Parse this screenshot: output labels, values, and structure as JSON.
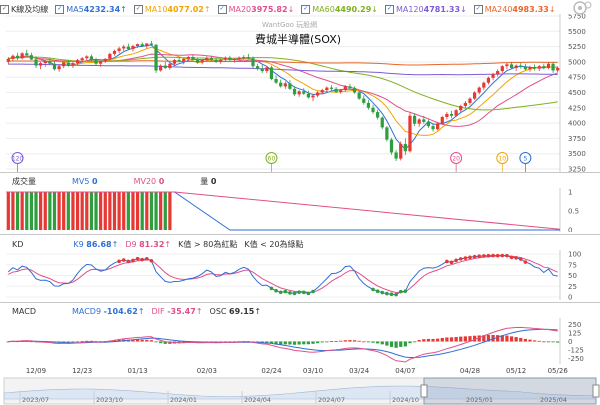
{
  "watermark": "WantGoo 玩股網",
  "price": {
    "title": "費城半導體(SOX)",
    "legend_prefix": "K線及均線",
    "ma": [
      {
        "label": "MA5",
        "value": "4232.34",
        "arrow": "↑",
        "color": "#2f6fd6"
      },
      {
        "label": "MA10",
        "value": "4077.02",
        "arrow": "↑",
        "color": "#f0a500"
      },
      {
        "label": "MA20",
        "value": "3975.82",
        "arrow": "↓",
        "color": "#e0508a"
      },
      {
        "label": "MA60",
        "value": "4490.29",
        "arrow": "↓",
        "color": "#80b020"
      },
      {
        "label": "MA120",
        "value": "4781.33",
        "arrow": "↓",
        "color": "#7b5cd6"
      },
      {
        "label": "MA240",
        "value": "4983.33",
        "arrow": "↓",
        "color": "#e8652a"
      }
    ],
    "markers": [
      {
        "label": "120",
        "x_index": 2,
        "color": "#7b5cd6"
      },
      {
        "label": "60",
        "x_index": 57,
        "color": "#80b020"
      },
      {
        "label": "20",
        "x_index": 97,
        "color": "#e0508a"
      },
      {
        "label": "10",
        "x_index": 107,
        "color": "#f0a500"
      },
      {
        "label": "5",
        "x_index": 112,
        "color": "#2f6fd6"
      }
    ]
  },
  "volume": {
    "label": "成交量",
    "mv5_label": "MV5",
    "mv5_value": "0",
    "mv20_label": "MV20",
    "mv20_value": "0",
    "qty_label": "量",
    "qty_value": "0"
  },
  "kd": {
    "label": "KD",
    "k_label": "K9",
    "k_value": "86.68",
    "k_arrow": "↑",
    "d_label": "D9",
    "d_value": "81.32",
    "d_arrow": "↑",
    "note1": "K值 > 80為紅點",
    "note2": "K值 < 20為綠點"
  },
  "macd": {
    "label": "MACD",
    "macd_label": "MACD9",
    "macd_value": "-104.62",
    "macd_arrow": "↑",
    "dif_label": "DIF",
    "dif_value": "-35.47",
    "dif_arrow": "↑",
    "osc_label": "OSC",
    "osc_value": "69.15",
    "osc_arrow": "↑"
  },
  "colors": {
    "up": "#e53935",
    "down": "#2e9e3e",
    "k_line": "#2f6fd6",
    "d_line": "#e0508a",
    "bar_green": "#2e9e3e",
    "bar_red": "#e53935"
  },
  "chart_data": {
    "type": "candlestick",
    "title": "費城半導體(SOX)",
    "date_labels": [
      {
        "label": "12/09",
        "index": 6
      },
      {
        "label": "12/23",
        "index": 16
      },
      {
        "label": "01/13",
        "index": 28
      },
      {
        "label": "02/03",
        "index": 43
      },
      {
        "label": "02/24",
        "index": 57
      },
      {
        "label": "03/10",
        "index": 66
      },
      {
        "label": "03/24",
        "index": 76
      },
      {
        "label": "04/07",
        "index": 86
      },
      {
        "label": "04/28",
        "index": 100
      },
      {
        "label": "05/12",
        "index": 110
      },
      {
        "label": "05/26",
        "index": 119
      }
    ],
    "overview_labels": [
      "2023/07",
      "2023/10",
      "2024/01",
      "2024/04",
      "2024/07",
      "2024/10",
      "2025/01",
      "2025/04"
    ],
    "price_axis": {
      "min": 3250,
      "max": 5750,
      "ticks": [
        5750,
        5500,
        5250,
        5000,
        4750,
        4500,
        4250,
        4000,
        3750,
        3500,
        3250
      ]
    },
    "ohlc": [
      [
        5000,
        5080,
        4960,
        5050
      ],
      [
        5050,
        5120,
        5010,
        5100
      ],
      [
        5100,
        5150,
        5030,
        5060
      ],
      [
        5060,
        5160,
        5040,
        5140
      ],
      [
        5140,
        5200,
        5090,
        5110
      ],
      [
        5110,
        5150,
        5030,
        5040
      ],
      [
        5040,
        5090,
        4900,
        4940
      ],
      [
        4940,
        5000,
        4880,
        4980
      ],
      [
        4980,
        5030,
        4920,
        5010
      ],
      [
        5010,
        5060,
        4950,
        4970
      ],
      [
        4970,
        5010,
        4860,
        4880
      ],
      [
        4880,
        4950,
        4840,
        4930
      ],
      [
        4930,
        5000,
        4900,
        4990
      ],
      [
        4990,
        5030,
        4920,
        4940
      ],
      [
        4940,
        5000,
        4900,
        4980
      ],
      [
        4980,
        5050,
        4950,
        5030
      ],
      [
        5030,
        5080,
        4990,
        5060
      ],
      [
        5060,
        5110,
        5020,
        5090
      ],
      [
        5090,
        5120,
        5010,
        5040
      ],
      [
        5040,
        5070,
        4950,
        4970
      ],
      [
        4970,
        5020,
        4920,
        5010
      ],
      [
        5010,
        5060,
        4980,
        5050
      ],
      [
        5050,
        5150,
        5030,
        5130
      ],
      [
        5130,
        5200,
        5100,
        5180
      ],
      [
        5180,
        5250,
        5140,
        5220
      ],
      [
        5220,
        5280,
        5180,
        5250
      ],
      [
        5250,
        5300,
        5200,
        5210
      ],
      [
        5210,
        5280,
        5170,
        5260
      ],
      [
        5260,
        5300,
        5230,
        5290
      ],
      [
        5290,
        5320,
        5240,
        5260
      ],
      [
        5260,
        5310,
        5220,
        5300
      ],
      [
        5300,
        5340,
        5260,
        5280
      ],
      [
        5280,
        5290,
        4820,
        4860
      ],
      [
        4860,
        4960,
        4840,
        4940
      ],
      [
        4940,
        5000,
        4880,
        4900
      ],
      [
        4900,
        4990,
        4870,
        4970
      ],
      [
        4970,
        5050,
        4950,
        5030
      ],
      [
        5030,
        5080,
        4990,
        5010
      ],
      [
        5010,
        5060,
        4960,
        5050
      ],
      [
        5050,
        5100,
        5020,
        5080
      ],
      [
        5080,
        5110,
        5020,
        5040
      ],
      [
        5040,
        5070,
        4970,
        4990
      ],
      [
        4990,
        5040,
        4960,
        5030
      ],
      [
        5030,
        5090,
        5000,
        5060
      ],
      [
        5060,
        5100,
        5010,
        5030
      ],
      [
        5030,
        5060,
        4980,
        5000
      ],
      [
        5000,
        5050,
        4970,
        5040
      ],
      [
        5040,
        5090,
        5010,
        5070
      ],
      [
        5070,
        5100,
        5020,
        5030
      ],
      [
        5030,
        5060,
        4990,
        5050
      ],
      [
        5050,
        5090,
        5020,
        5070
      ],
      [
        5070,
        5110,
        5040,
        5080
      ],
      [
        5080,
        5130,
        5040,
        5060
      ],
      [
        5060,
        5090,
        4900,
        4930
      ],
      [
        4930,
        4970,
        4860,
        4890
      ],
      [
        4890,
        4950,
        4820,
        4850
      ],
      [
        4850,
        4930,
        4820,
        4910
      ],
      [
        4910,
        4940,
        4700,
        4720
      ],
      [
        4720,
        4780,
        4640,
        4660
      ],
      [
        4660,
        4710,
        4580,
        4600
      ],
      [
        4600,
        4680,
        4560,
        4650
      ],
      [
        4650,
        4700,
        4540,
        4560
      ],
      [
        4560,
        4600,
        4440,
        4470
      ],
      [
        4470,
        4540,
        4430,
        4520
      ],
      [
        4520,
        4570,
        4460,
        4480
      ],
      [
        4480,
        4530,
        4400,
        4420
      ],
      [
        4420,
        4480,
        4360,
        4450
      ],
      [
        4450,
        4520,
        4420,
        4500
      ],
      [
        4500,
        4560,
        4470,
        4540
      ],
      [
        4540,
        4600,
        4510,
        4580
      ],
      [
        4580,
        4620,
        4530,
        4560
      ],
      [
        4560,
        4590,
        4490,
        4510
      ],
      [
        4510,
        4560,
        4480,
        4540
      ],
      [
        4540,
        4620,
        4520,
        4600
      ],
      [
        4600,
        4640,
        4550,
        4570
      ],
      [
        4570,
        4600,
        4480,
        4500
      ],
      [
        4500,
        4520,
        4380,
        4400
      ],
      [
        4400,
        4450,
        4300,
        4330
      ],
      [
        4330,
        4380,
        4220,
        4250
      ],
      [
        4250,
        4300,
        4150,
        4180
      ],
      [
        4180,
        4220,
        4060,
        4090
      ],
      [
        4090,
        4110,
        3900,
        3930
      ],
      [
        3930,
        3950,
        3700,
        3730
      ],
      [
        3730,
        3760,
        3480,
        3520
      ],
      [
        3520,
        3560,
        3380,
        3420
      ],
      [
        3420,
        3700,
        3390,
        3660
      ],
      [
        3660,
        3750,
        3480,
        3540
      ],
      [
        3540,
        4180,
        3520,
        4120
      ],
      [
        4120,
        4160,
        3950,
        3990
      ],
      [
        3990,
        4080,
        3940,
        4060
      ],
      [
        4060,
        4120,
        3990,
        4020
      ],
      [
        4020,
        4060,
        3920,
        3950
      ],
      [
        3950,
        3980,
        3860,
        3900
      ],
      [
        3900,
        4010,
        3880,
        3990
      ],
      [
        3990,
        4120,
        3970,
        4100
      ],
      [
        4100,
        4180,
        4060,
        4150
      ],
      [
        4150,
        4200,
        4080,
        4120
      ],
      [
        4120,
        4230,
        4100,
        4210
      ],
      [
        4210,
        4300,
        4180,
        4280
      ],
      [
        4280,
        4360,
        4240,
        4330
      ],
      [
        4330,
        4420,
        4300,
        4400
      ],
      [
        4400,
        4520,
        4380,
        4500
      ],
      [
        4500,
        4600,
        4470,
        4580
      ],
      [
        4580,
        4680,
        4540,
        4660
      ],
      [
        4660,
        4760,
        4630,
        4740
      ],
      [
        4740,
        4820,
        4700,
        4800
      ],
      [
        4800,
        4880,
        4760,
        4850
      ],
      [
        4850,
        4950,
        4820,
        4930
      ],
      [
        4930,
        4990,
        4880,
        4960
      ],
      [
        4960,
        5000,
        4880,
        4900
      ],
      [
        4900,
        4960,
        4850,
        4940
      ],
      [
        4940,
        4990,
        4890,
        4920
      ],
      [
        4920,
        4970,
        4860,
        4880
      ],
      [
        4880,
        4940,
        4840,
        4910
      ],
      [
        4910,
        4960,
        4860,
        4890
      ],
      [
        4890,
        4950,
        4850,
        4930
      ],
      [
        4930,
        4970,
        4880,
        4900
      ],
      [
        4900,
        4990,
        4880,
        4970
      ],
      [
        4970,
        5000,
        4820,
        4860
      ],
      [
        4860,
        4930,
        4830,
        4900
      ]
    ],
    "kd_axis": {
      "min": 0,
      "max": 100,
      "ticks": [
        100,
        75,
        50,
        25,
        0
      ]
    },
    "macd_axis": {
      "min": -300,
      "max": 300,
      "ticks": [
        250,
        125,
        0,
        -125,
        -250
      ]
    },
    "volume_axis": {
      "min": 0,
      "max": 1,
      "ticks": [
        1,
        0.5,
        0
      ]
    },
    "volume_note": "Volume bars shown only for first 36 sessions"
  }
}
